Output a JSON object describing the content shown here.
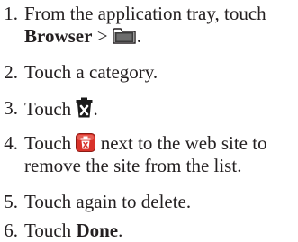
{
  "steps": [
    {
      "number": "1.",
      "line1": "From the application tray, touch",
      "bold": "Browser",
      "separator": " > ",
      "icon": "folder-icon",
      "end": "."
    },
    {
      "number": "2.",
      "text": "Touch a category."
    },
    {
      "number": "3.",
      "prefix": "Touch ",
      "icon": "trash-icon",
      "end": "."
    },
    {
      "number": "4.",
      "prefix": "Touch ",
      "icon": "red-delete-icon",
      "suffix": " next to the web site to",
      "line2": "remove the site from the list."
    },
    {
      "number": "5.",
      "text": "Touch again to delete."
    },
    {
      "number": "6.",
      "prefix": "Touch ",
      "bold": "Done",
      "end": "."
    }
  ],
  "colors": {
    "text": "#231f20",
    "delete_icon_red": "#d9322a"
  }
}
